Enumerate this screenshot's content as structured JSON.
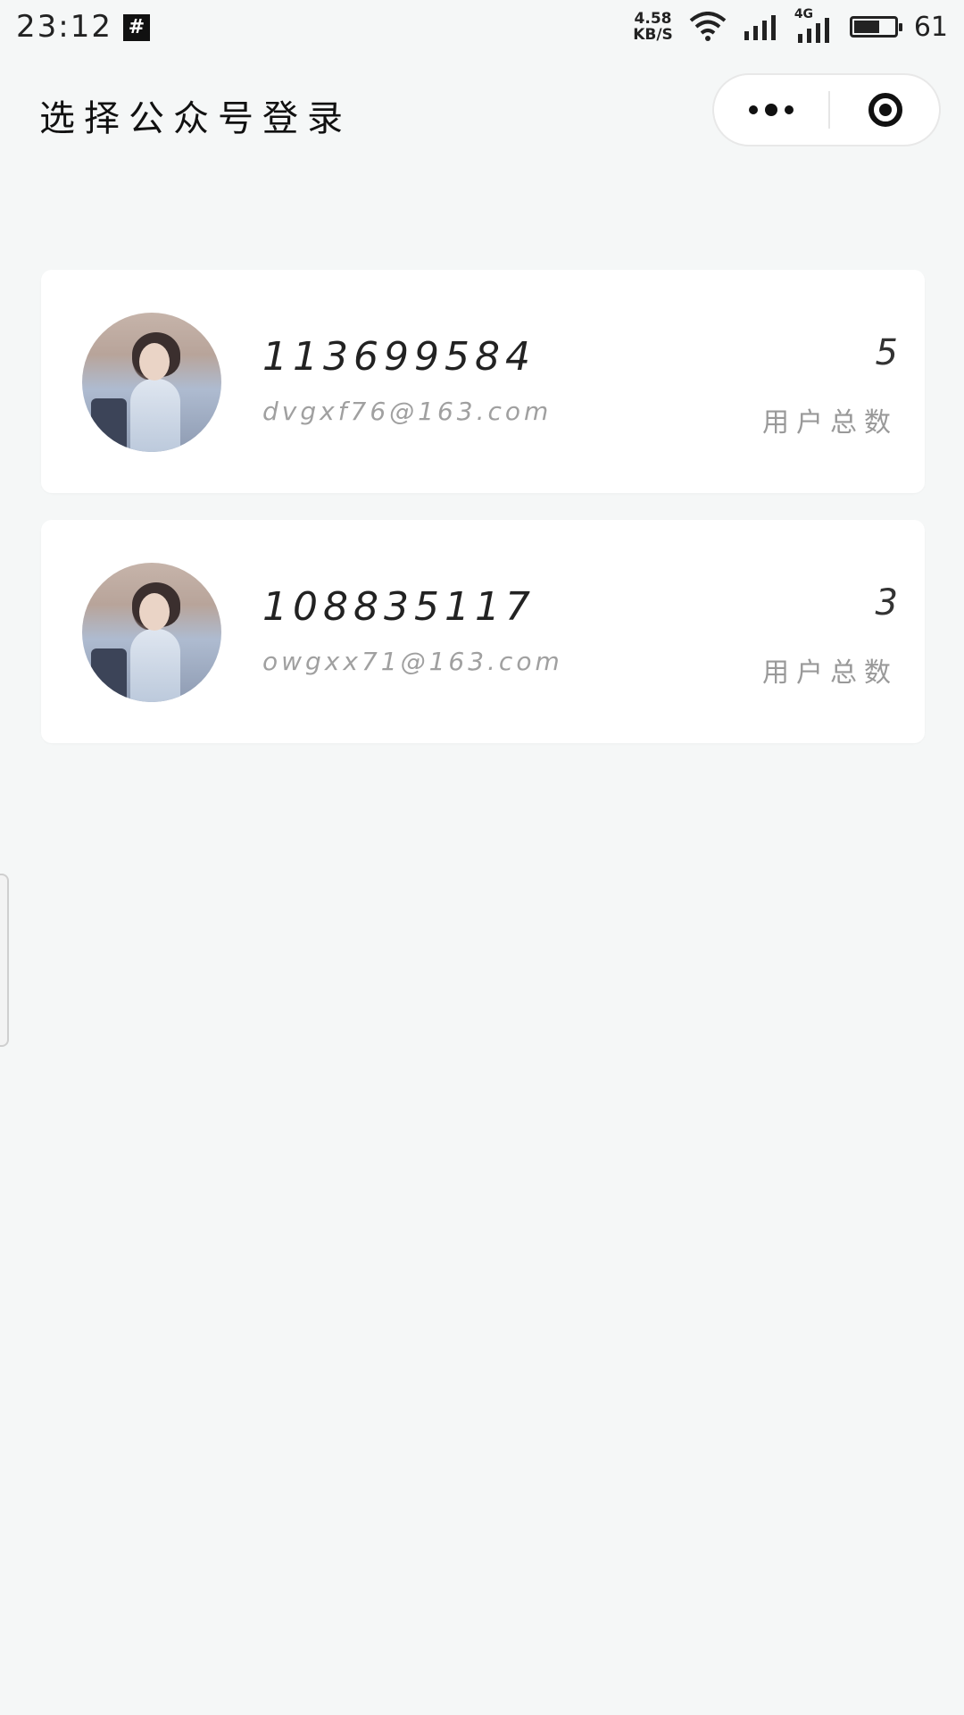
{
  "status_bar": {
    "time": "23:12",
    "grid_icon_symbol": "#",
    "net_speed_value": "4.58",
    "net_speed_unit": "KB/S",
    "network_type": "4G",
    "battery_level": "61",
    "icons": [
      "grid-icon",
      "wifi-icon",
      "signal-icon",
      "signal-4g-icon",
      "battery-icon"
    ]
  },
  "header": {
    "title": "选择公众号登录",
    "capsule": {
      "more_icon": "more-dots-icon",
      "close_icon": "target-close-icon"
    }
  },
  "accounts": [
    {
      "id": "113699584",
      "email": "dvgxf76@163.com",
      "user_count": "5",
      "user_count_label": "用户总数"
    },
    {
      "id": "108835117",
      "email": "owgxx71@163.com",
      "user_count": "3",
      "user_count_label": "用户总数"
    }
  ],
  "colors": {
    "background": "#f5f7f7",
    "card": "#ffffff",
    "text_primary": "#222222",
    "text_secondary": "#a0a0a0"
  }
}
